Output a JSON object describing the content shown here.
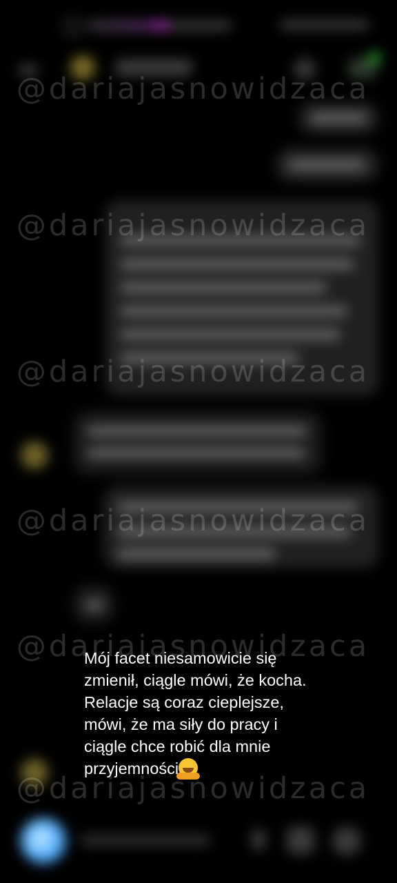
{
  "watermark": {
    "text": "@dariajasnowidzaca"
  },
  "caption": {
    "text": "Mój facet niesamowicie się\nzmienił, ciągle mówi, że kocha.\nRelacje są coraz cieplejsze,\nmówi, że ma siły do pracy i\nciągle chce robić dla mnie\nprzyjemności",
    "emoji": "hugging-face"
  },
  "colors": {
    "background": "#000000",
    "accent_blue": "#5ab4ff",
    "online_green": "#2fc02f"
  }
}
